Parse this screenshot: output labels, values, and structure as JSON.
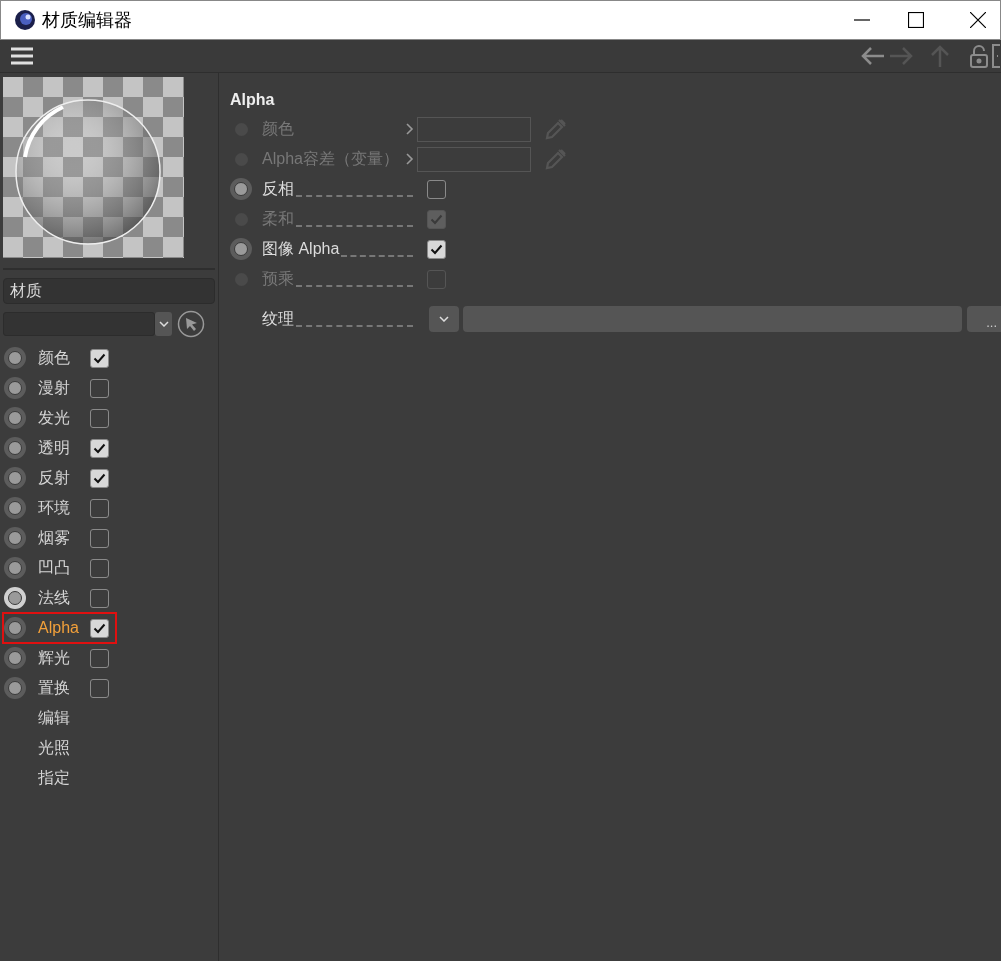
{
  "window": {
    "title": "材质编辑器"
  },
  "material_name": {
    "value": "材质"
  },
  "channels": [
    {
      "label": "颜色",
      "kind": "channel",
      "checked": true,
      "selected": false,
      "highlighted": false
    },
    {
      "label": "漫射",
      "kind": "channel",
      "checked": false,
      "selected": false,
      "highlighted": false
    },
    {
      "label": "发光",
      "kind": "channel",
      "checked": false,
      "selected": false,
      "highlighted": false
    },
    {
      "label": "透明",
      "kind": "channel",
      "checked": true,
      "selected": false,
      "highlighted": false
    },
    {
      "label": "反射",
      "kind": "channel",
      "checked": true,
      "selected": false,
      "highlighted": false
    },
    {
      "label": "环境",
      "kind": "channel",
      "checked": false,
      "selected": false,
      "highlighted": false
    },
    {
      "label": "烟雾",
      "kind": "channel",
      "checked": false,
      "selected": false,
      "highlighted": false
    },
    {
      "label": "凹凸",
      "kind": "channel",
      "checked": false,
      "selected": false,
      "highlighted": false
    },
    {
      "label": "法线",
      "kind": "channel",
      "checked": false,
      "selected": false,
      "highlighted": true
    },
    {
      "label": "Alpha",
      "kind": "channel",
      "checked": true,
      "selected": true,
      "highlighted": false
    },
    {
      "label": "辉光",
      "kind": "channel",
      "checked": false,
      "selected": false,
      "highlighted": false
    },
    {
      "label": "置换",
      "kind": "channel",
      "checked": false,
      "selected": false,
      "highlighted": false
    },
    {
      "label": "编辑",
      "kind": "page",
      "selected": false
    },
    {
      "label": "光照",
      "kind": "page",
      "selected": false
    },
    {
      "label": "指定",
      "kind": "page",
      "selected": false
    }
  ],
  "section": {
    "title": "Alpha"
  },
  "parameters": [
    {
      "label": "颜色",
      "kind": "color",
      "disabled": true
    },
    {
      "label": "Alpha容差（变量）",
      "kind": "color",
      "disabled": true
    },
    {
      "label": "反相",
      "kind": "checkbox",
      "disabled": false,
      "checked": false
    },
    {
      "label": "柔和",
      "kind": "checkbox",
      "disabled": true,
      "checked": true
    },
    {
      "label": "图像 Alpha",
      "kind": "checkbox",
      "disabled": false,
      "checked": true
    },
    {
      "label": "预乘",
      "kind": "checkbox",
      "disabled": true,
      "checked": false
    },
    {
      "label": "纹理",
      "kind": "texture",
      "button": "..."
    }
  ]
}
